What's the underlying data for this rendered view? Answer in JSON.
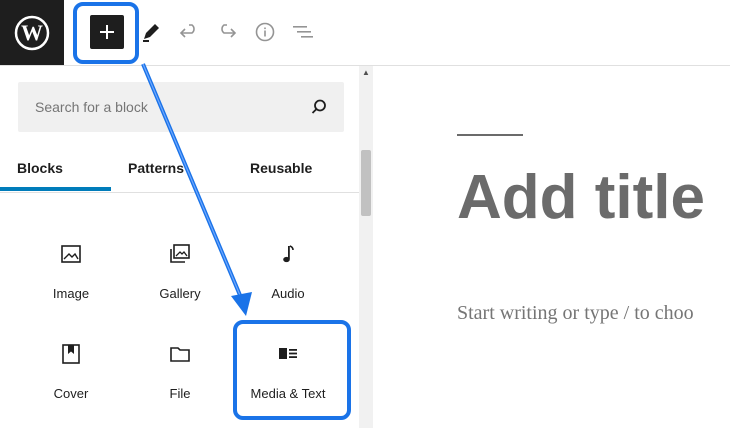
{
  "toolbar": {
    "logo_icon": "wordpress-logo-icon",
    "buttons": [
      "add-block-icon",
      "edit-pencil-icon",
      "undo-icon",
      "redo-icon",
      "info-icon",
      "list-view-icon"
    ]
  },
  "inserter": {
    "search_placeholder": "Search for a block",
    "tabs": [
      {
        "label": "Blocks",
        "active": true
      },
      {
        "label": "Patterns",
        "active": false
      },
      {
        "label": "Reusable",
        "active": false
      }
    ],
    "blocks": [
      {
        "label": "Image",
        "icon": "image-icon"
      },
      {
        "label": "Gallery",
        "icon": "gallery-icon"
      },
      {
        "label": "Audio",
        "icon": "music-note-icon"
      },
      {
        "label": "Cover",
        "icon": "cover-icon"
      },
      {
        "label": "File",
        "icon": "folder-icon"
      },
      {
        "label": "Media & Text",
        "icon": "media-text-icon"
      }
    ]
  },
  "editor": {
    "title_placeholder": "Add title",
    "body_placeholder": "Start writing or type / to choo"
  },
  "colors": {
    "highlight": "#1a73e8",
    "accent": "#007cba",
    "dark": "#1e1e1e"
  }
}
